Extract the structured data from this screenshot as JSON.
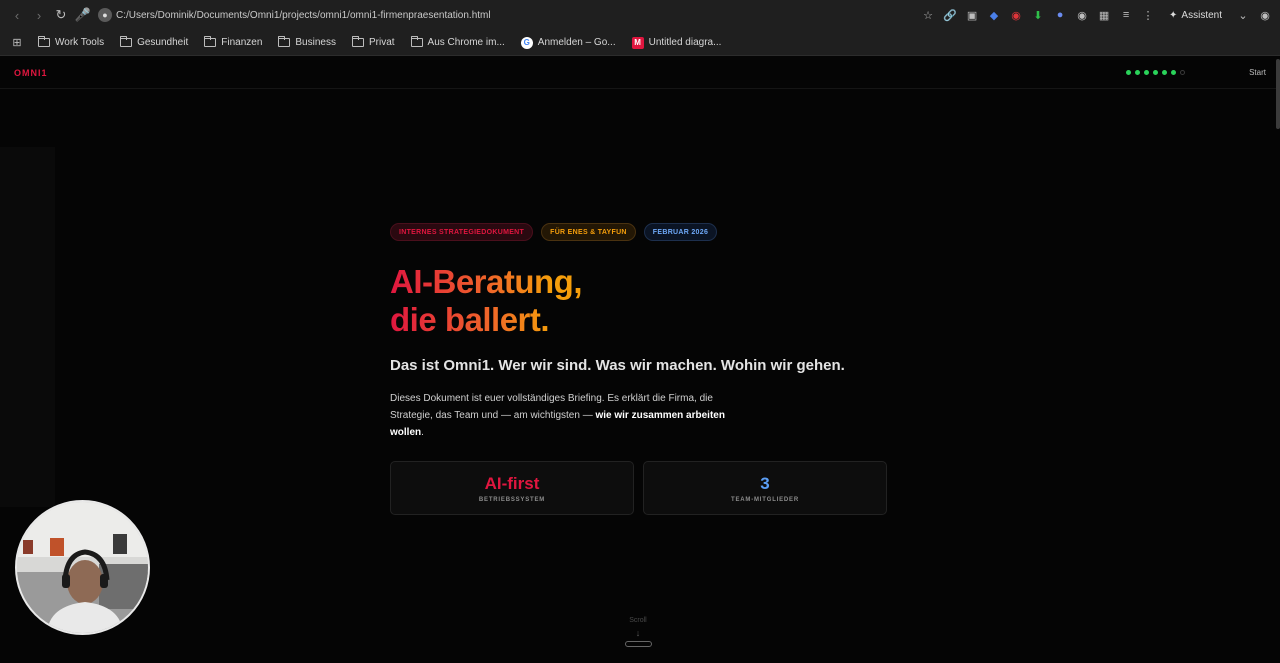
{
  "browser": {
    "url": "C:/Users/Dominik/Documents/Omni1/projects/omni1/omni1-firmenpraesentation.html",
    "assistant_label": "Assistent",
    "bookmarks": [
      {
        "label": "Work Tools",
        "icon": "folder-icon"
      },
      {
        "label": "Gesundheit",
        "icon": "folder-icon"
      },
      {
        "label": "Finanzen",
        "icon": "folder-icon"
      },
      {
        "label": "Business",
        "icon": "folder-icon"
      },
      {
        "label": "Privat",
        "icon": "folder-icon"
      },
      {
        "label": "Aus Chrome im...",
        "icon": "folder-icon"
      },
      {
        "label": "Anmelden – Go...",
        "icon": "google-icon"
      },
      {
        "label": "Untitled diagra...",
        "icon": "miro-icon"
      }
    ]
  },
  "site": {
    "logo": "OMNI1",
    "nav_start": "Start",
    "progress": {
      "total": 7,
      "active": 6
    }
  },
  "hero": {
    "badges": [
      {
        "label": "INTERNES STRATEGIEDOKUMENT",
        "color": "#e0163f"
      },
      {
        "label": "FÜR ENES & TAYFUN",
        "color": "#f59e0b"
      },
      {
        "label": "FEBRUAR 2026",
        "color": "#6ea8f7"
      }
    ],
    "headline_line1": "AI-Beratung,",
    "headline_line2": "die ballert.",
    "subheadline": "Das ist Omni1. Wer wir sind. Was wir machen. Wohin wir gehen.",
    "body_text": "Dieses Dokument ist euer vollständiges Briefing. Es erklärt die Firma, die Strategie, das Team und — am wichtigsten — ",
    "body_bold": "wie wir zusammen arbeiten wollen",
    "body_end": ".",
    "stats": [
      {
        "value": "AI-first",
        "label": "BETRIEBSSYSTEM",
        "color": "#e0163f"
      },
      {
        "value": "3",
        "label": "TEAM-MITGLIEDER",
        "color": "#5b9ef5"
      }
    ],
    "scroll_label": "Scroll"
  },
  "colors": {
    "accent": "#e0163f",
    "progress_dot": "#2ad35a"
  }
}
